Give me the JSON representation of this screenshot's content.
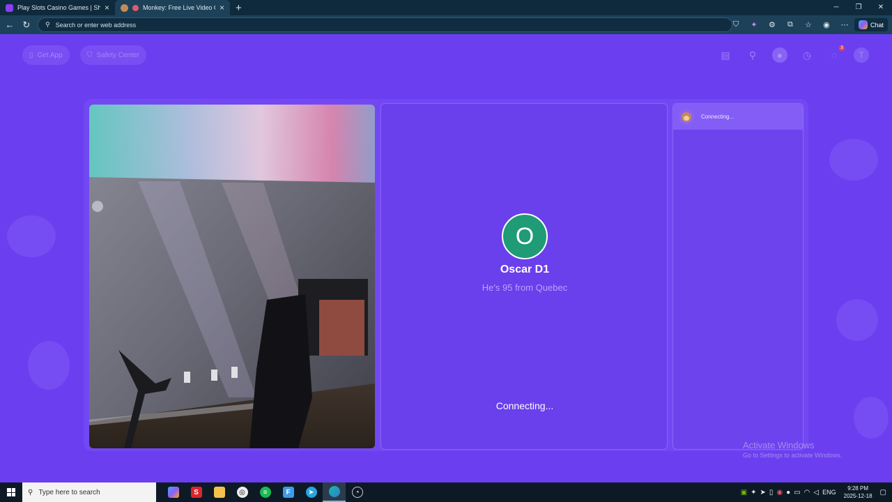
{
  "browser": {
    "tabs": [
      {
        "title": "Play Slots Casino Games | Shuffle",
        "favicon_color": "#8a3ff2",
        "active": false
      },
      {
        "title": "Monkey: Free Live Video Chat",
        "favicon_color": "#c58a55",
        "active": true
      }
    ],
    "new_tab_label": "+",
    "address_placeholder": "Search or enter web address",
    "chat_label": "Chat"
  },
  "site_header": {
    "get_app_label": "Get App",
    "safety_label": "Safety Center",
    "profile_initial": "T",
    "messages_badge": "3"
  },
  "match": {
    "initial": "O",
    "name": "Oscar D1",
    "description": "He's 95 from Quebec",
    "status": "Connecting..."
  },
  "sidebar": {
    "status": "Connecting..."
  },
  "watermark": {
    "line1": "Activate Windows",
    "line2": "Go to Settings to activate Windows."
  },
  "taskbar": {
    "search_placeholder": "Type here to search",
    "language": "ENG",
    "time": "9:28 PM",
    "date": "2025-12-18"
  },
  "colors": {
    "page_bg": "#6b3ff0",
    "avatar_bg": "#1f9b76",
    "accent": "#b9a3ff"
  }
}
